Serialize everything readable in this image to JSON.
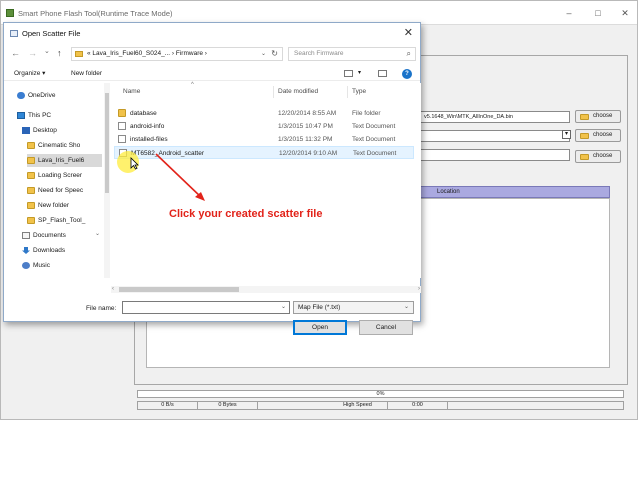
{
  "background_app": {
    "title": "Smart Phone Flash Tool(Runtime Trace Mode)",
    "controls": [
      "–",
      "□",
      "✕"
    ],
    "da_path": "v5.1648_Win\\MTK_AllInOne_DA.bin",
    "choose_label": "choose",
    "location_header": "Location",
    "progress_percent": "0%",
    "status": {
      "speed": "0 B/s",
      "bytes": "0 Bytes",
      "mode": "High Speed",
      "time": "0:00"
    }
  },
  "dialog": {
    "title": "Open Scatter File",
    "close": "✕",
    "nav": {
      "back": "←",
      "forward": "→",
      "dropdown": "⌄",
      "up": "↑"
    },
    "breadcrumb": "« Lava_Iris_Fuel60_S024_... › Firmware ›",
    "search_placeholder": "Search Firmware",
    "organize": "Organize ▾",
    "new_folder": "New folder",
    "nav_pane": [
      {
        "label": "OneDrive",
        "icon": "cloud-icon"
      },
      {
        "label": "This PC",
        "icon": "computer-icon"
      },
      {
        "label": "Desktop",
        "icon": "desktop-icon"
      },
      {
        "label": "Cinematic Sho",
        "icon": "folder-icon"
      },
      {
        "label": "Lava_Iris_Fuel6",
        "icon": "folder-icon"
      },
      {
        "label": "Loading Screer",
        "icon": "folder-icon"
      },
      {
        "label": "Need for Speec",
        "icon": "folder-icon"
      },
      {
        "label": "New folder",
        "icon": "folder-icon"
      },
      {
        "label": "SP_Flash_Tool_",
        "icon": "folder-icon"
      },
      {
        "label": "Documents",
        "icon": "documents-icon"
      },
      {
        "label": "Downloads",
        "icon": "download-icon"
      },
      {
        "label": "Music",
        "icon": "music-icon"
      }
    ],
    "columns": {
      "name": "Name",
      "date": "Date modified",
      "type": "Type"
    },
    "files": [
      {
        "name": "database",
        "date": "12/20/2014 8:55 AM",
        "type": "File folder",
        "icon": "folder-icon"
      },
      {
        "name": "android-info",
        "date": "1/3/2015 10:47 PM",
        "type": "Text Document",
        "icon": "text-file-icon"
      },
      {
        "name": "installed-files",
        "date": "1/3/2015 11:32 PM",
        "type": "Text Document",
        "icon": "text-file-icon"
      },
      {
        "name": "MT6582_Android_scatter",
        "date": "12/20/2014 9:10 AM",
        "type": "Text Document",
        "icon": "text-file-icon"
      }
    ],
    "file_name_label": "File name:",
    "file_name_value": "",
    "file_type": "Map File (*.txt)",
    "open_label": "Open",
    "cancel_label": "Cancel"
  },
  "annotation": {
    "text": "Click your created scatter file",
    "color": "#e2231a"
  }
}
